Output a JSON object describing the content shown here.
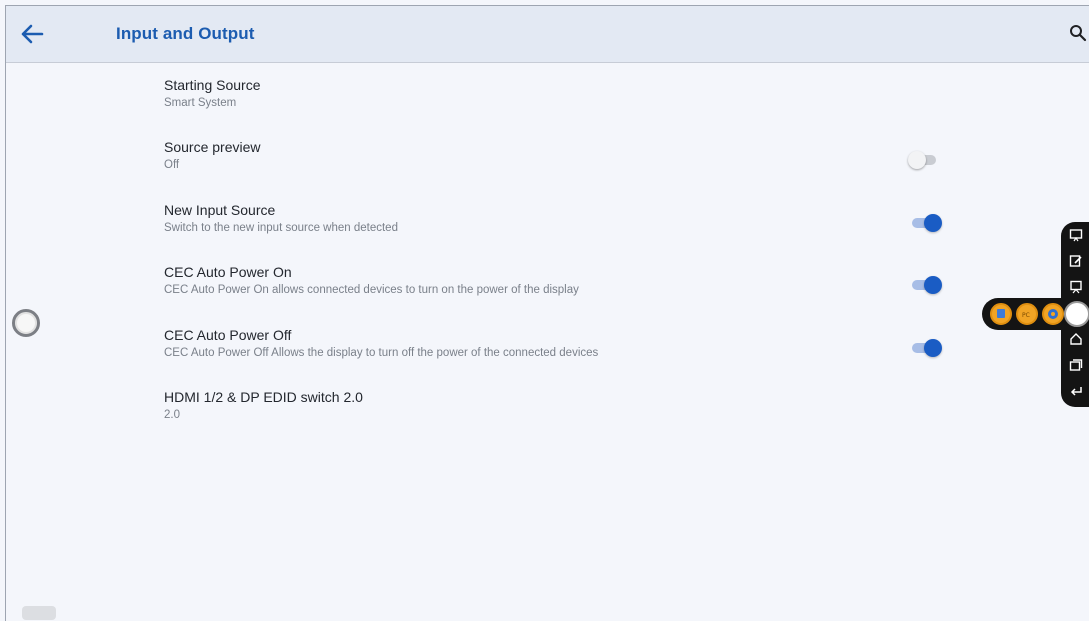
{
  "header": {
    "title": "Input and Output",
    "back_icon": "arrow-left-icon",
    "search_icon": "search-icon"
  },
  "colors": {
    "accent": "#1a5cc4",
    "title_text": "#1c5cb0",
    "appbar_bg": "#e3e9f3",
    "page_bg": "#f4f6fb",
    "dock_bg": "#141414"
  },
  "settings": [
    {
      "title": "Starting Source",
      "subtitle": "Smart System",
      "toggle": null
    },
    {
      "title": "Source preview",
      "subtitle": "Off",
      "toggle": false
    },
    {
      "title": "New Input Source",
      "subtitle": "Switch to the new input source when detected",
      "toggle": true
    },
    {
      "title": "CEC Auto Power On",
      "subtitle": "CEC Auto Power On allows connected devices to turn on the power of the display",
      "toggle": true
    },
    {
      "title": "CEC Auto Power Off",
      "subtitle": "CEC Auto Power Off Allows the display to turn off the power of the connected devices",
      "toggle": true
    },
    {
      "title": "HDMI 1/2 & DP EDID switch 2.0",
      "subtitle": "2.0",
      "toggle": null
    }
  ],
  "side_dock": {
    "icons": [
      "whiteboard-icon",
      "annotate-icon",
      "screen-share-icon",
      "home-icon",
      "multitask-icon",
      "back-icon"
    ]
  },
  "quick_bar": {
    "apps": [
      "app-one-icon",
      "app-pc-icon",
      "settings-gear-icon"
    ],
    "center": "floating-menu-icon"
  }
}
